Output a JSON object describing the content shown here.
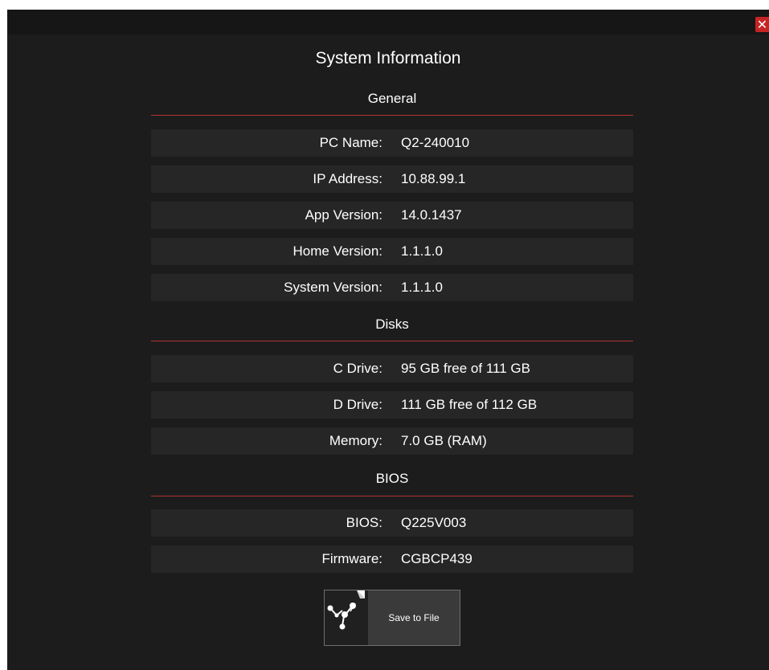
{
  "dialog": {
    "title": "System Information",
    "close_label": "✕"
  },
  "general": {
    "heading": "General",
    "rows": [
      {
        "label": "PC Name:",
        "value": "Q2-240010"
      },
      {
        "label": "IP Address:",
        "value": "10.88.99.1"
      },
      {
        "label": "App Version:",
        "value": "14.0.1437"
      },
      {
        "label": "Home Version:",
        "value": "1.1.1.0"
      },
      {
        "label": "System Version:",
        "value": "1.1.1.0"
      }
    ]
  },
  "disks": {
    "heading": "Disks",
    "rows": [
      {
        "label": "C Drive:",
        "value": "95 GB free of 111 GB"
      },
      {
        "label": "D Drive:",
        "value": "111 GB free of 112 GB"
      },
      {
        "label": "Memory:",
        "value": "7.0 GB (RAM)"
      }
    ]
  },
  "bios": {
    "heading": "BIOS",
    "rows": [
      {
        "label": "BIOS:",
        "value": "Q225V003"
      },
      {
        "label": "Firmware:",
        "value": "CGBCP439"
      }
    ]
  },
  "actions": {
    "save_label": "Save to File",
    "save_icon": "share-nodes-icon"
  },
  "colors": {
    "background": "#1c1c1c",
    "row": "#262626",
    "divider": "#b33232",
    "close": "#c62424"
  }
}
